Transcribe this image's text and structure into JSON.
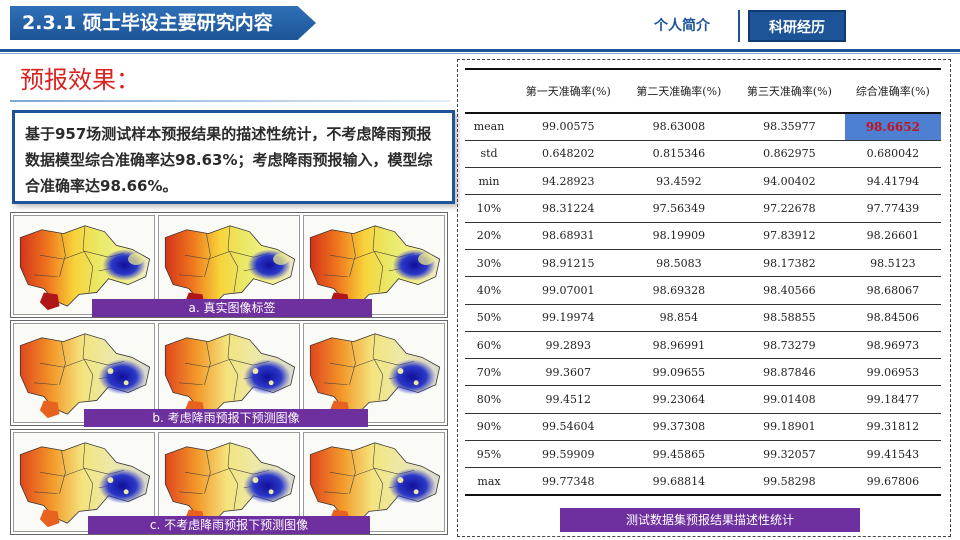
{
  "header": {
    "title": "2.3.1 硕士毕设主要研究内容",
    "nav": [
      {
        "label": "个人简介",
        "active": false
      },
      {
        "label": "科研经历",
        "active": true
      }
    ]
  },
  "section": {
    "title": "预报效果：",
    "summary": "基于957场测试样本预报结果的描述性统计，不考虑降雨预报数据模型综合准确率达98.63%；考虑降雨预报输入，模型综合准确率达98.66%。"
  },
  "figures": {
    "captions": {
      "a": "a. 真实图像标签",
      "b": "b. 考虑降雨预报下预测图像",
      "c": "c. 不考虑降雨预报下预测图像"
    }
  },
  "table": {
    "caption": "测试数据集预报结果描述性统计",
    "headers": [
      "",
      "第一天准确率(%)",
      "第二天准确率(%)",
      "第三天准确率(%)",
      "综合准确率(%)"
    ],
    "highlight": {
      "row": 0,
      "col": 4,
      "color": "#4f7fd0",
      "text_color": "#c2141e"
    },
    "rows": [
      [
        "mean",
        "99.00575",
        "98.63008",
        "98.35977",
        "98.6652"
      ],
      [
        "std",
        "0.648202",
        "0.815346",
        "0.862975",
        "0.680042"
      ],
      [
        "min",
        "94.28923",
        "93.4592",
        "94.00402",
        "94.41794"
      ],
      [
        "10%",
        "98.31224",
        "97.56349",
        "97.22678",
        "97.77439"
      ],
      [
        "20%",
        "98.68931",
        "98.19909",
        "97.83912",
        "98.26601"
      ],
      [
        "30%",
        "98.91215",
        "98.5083",
        "98.17382",
        "98.5123"
      ],
      [
        "40%",
        "99.07001",
        "98.69328",
        "98.40566",
        "98.68067"
      ],
      [
        "50%",
        "99.19974",
        "98.854",
        "98.58855",
        "98.84506"
      ],
      [
        "60%",
        "99.2893",
        "98.96991",
        "98.73279",
        "98.96973"
      ],
      [
        "70%",
        "99.3607",
        "99.09655",
        "98.87846",
        "99.06953"
      ],
      [
        "80%",
        "99.4512",
        "99.23064",
        "99.01408",
        "99.18477"
      ],
      [
        "90%",
        "99.54604",
        "99.37308",
        "99.18901",
        "99.31812"
      ],
      [
        "95%",
        "99.59909",
        "99.45865",
        "99.32057",
        "99.41543"
      ],
      [
        "max",
        "99.77348",
        "99.68814",
        "99.58298",
        "99.67806"
      ]
    ]
  },
  "colors": {
    "brand": "#1c5497",
    "accent_red": "#d8231f",
    "caption_purple": "#6e2f9f"
  }
}
